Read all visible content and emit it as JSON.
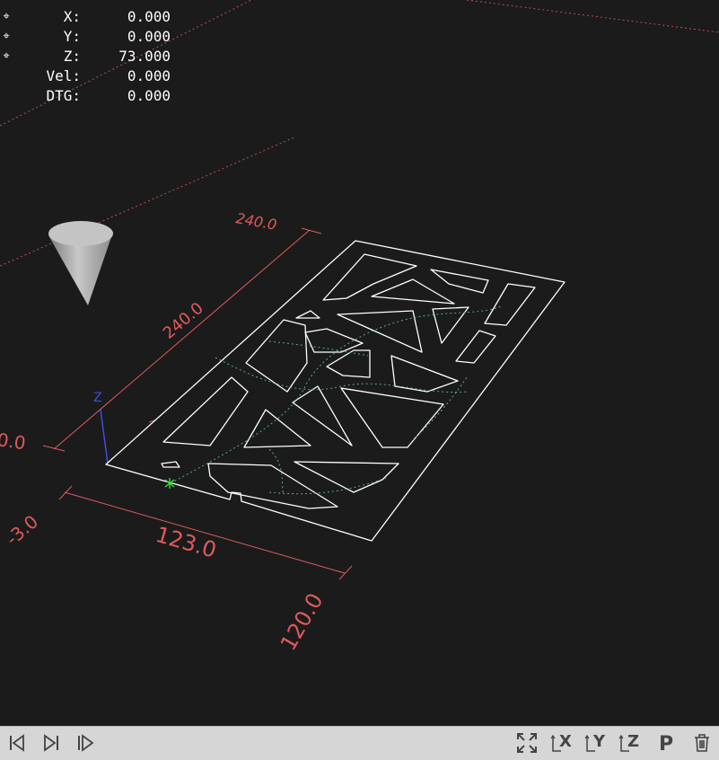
{
  "dro": {
    "rows": [
      {
        "label": "X:",
        "value": "0.000",
        "homed": true
      },
      {
        "label": "Y:",
        "value": "0.000",
        "homed": true
      },
      {
        "label": "Z:",
        "value": "73.000",
        "homed": true
      },
      {
        "label": "Vel:",
        "value": "0.000",
        "homed": false
      },
      {
        "label": "DTG:",
        "value": "0.000",
        "homed": false
      }
    ]
  },
  "dimensions": {
    "top": "240.0",
    "left_diagonal": "240.0",
    "left_edge": "0.0",
    "front_left": "-3.0",
    "front": "123.0",
    "front_right": "120.0"
  },
  "axis_label_z": "Z",
  "colors": {
    "background": "#1b1b1b",
    "limits": "#e05a5a",
    "toolpath": "#ffffff",
    "rapid": "#5aa7a0",
    "z_axis": "#3a4fe0",
    "origin": "#39e639",
    "toolbar": "#d6d6d6"
  },
  "toolbar": {
    "icons": [
      "first-icon",
      "step-icon",
      "run-from-line-icon",
      "zoom-fit-icon",
      "view-x-icon",
      "view-y-icon",
      "view-z-icon",
      "view-p-icon",
      "clear-trash-icon"
    ],
    "view_x_label": "X",
    "view_y_label": "Y",
    "view_z_label": "Z",
    "view_p_label": "P"
  }
}
